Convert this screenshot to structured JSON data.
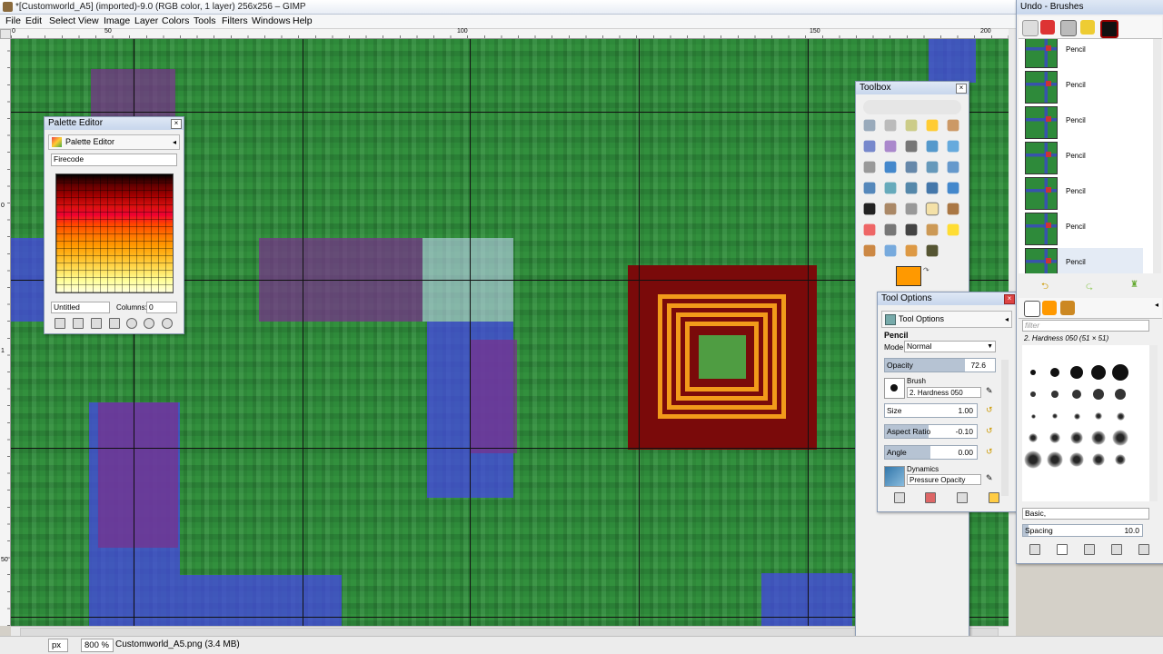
{
  "window": {
    "title": "*[Customworld_A5] (imported)-9.0 (RGB color, 1 layer) 256x256 – GIMP"
  },
  "menu": [
    "File",
    "Edit",
    "Select",
    "View",
    "Image",
    "Layer",
    "Colors",
    "Tools",
    "Filters",
    "Windows",
    "Help"
  ],
  "ruler": {
    "top_labels": [
      "0",
      "50",
      "100",
      "150",
      "200"
    ],
    "left_labels": [
      "0",
      "50",
      "1"
    ]
  },
  "palette_editor": {
    "title": "Palette Editor",
    "tab_label": "Palette Editor",
    "palette_name": "Firecode",
    "name_field": "Untitled",
    "columns_label": "Columns:",
    "columns_value": "0"
  },
  "toolbox": {
    "title": "Toolbox",
    "fg_color": "#ff9900",
    "bg_color": "#ffffff"
  },
  "tool_options": {
    "title": "Tool Options",
    "tab_label": "Tool Options",
    "tool_name": "Pencil",
    "mode_label": "Mode:",
    "mode_value": "Normal",
    "opacity_label": "Opacity",
    "opacity_value": "72.6",
    "opacity_fraction": 0.726,
    "brush_label": "Brush",
    "brush_value": "2. Hardness 050",
    "size_label": "Size",
    "size_value": "1.00",
    "aspect_label": "Aspect Ratio",
    "aspect_value": "-0.10",
    "angle_label": "Angle",
    "angle_value": "0.00",
    "dynamics_label": "Dynamics",
    "dynamics_value": "Pressure Opacity"
  },
  "undo_brushes": {
    "title": "Undo - Brushes",
    "undo_items": [
      "Pencil",
      "Pencil",
      "Pencil",
      "Pencil",
      "Pencil",
      "Pencil",
      "Pencil"
    ],
    "filter_placeholder": "filter",
    "brush_selected": "2. Hardness 050 (51 × 51)",
    "tag_value": "Basic,",
    "spacing_label": "Spacing",
    "spacing_value": "10.0"
  },
  "status": {
    "unit": "px",
    "zoom": "800 %",
    "file": "Customworld_A5.png (3.4 MB)"
  }
}
